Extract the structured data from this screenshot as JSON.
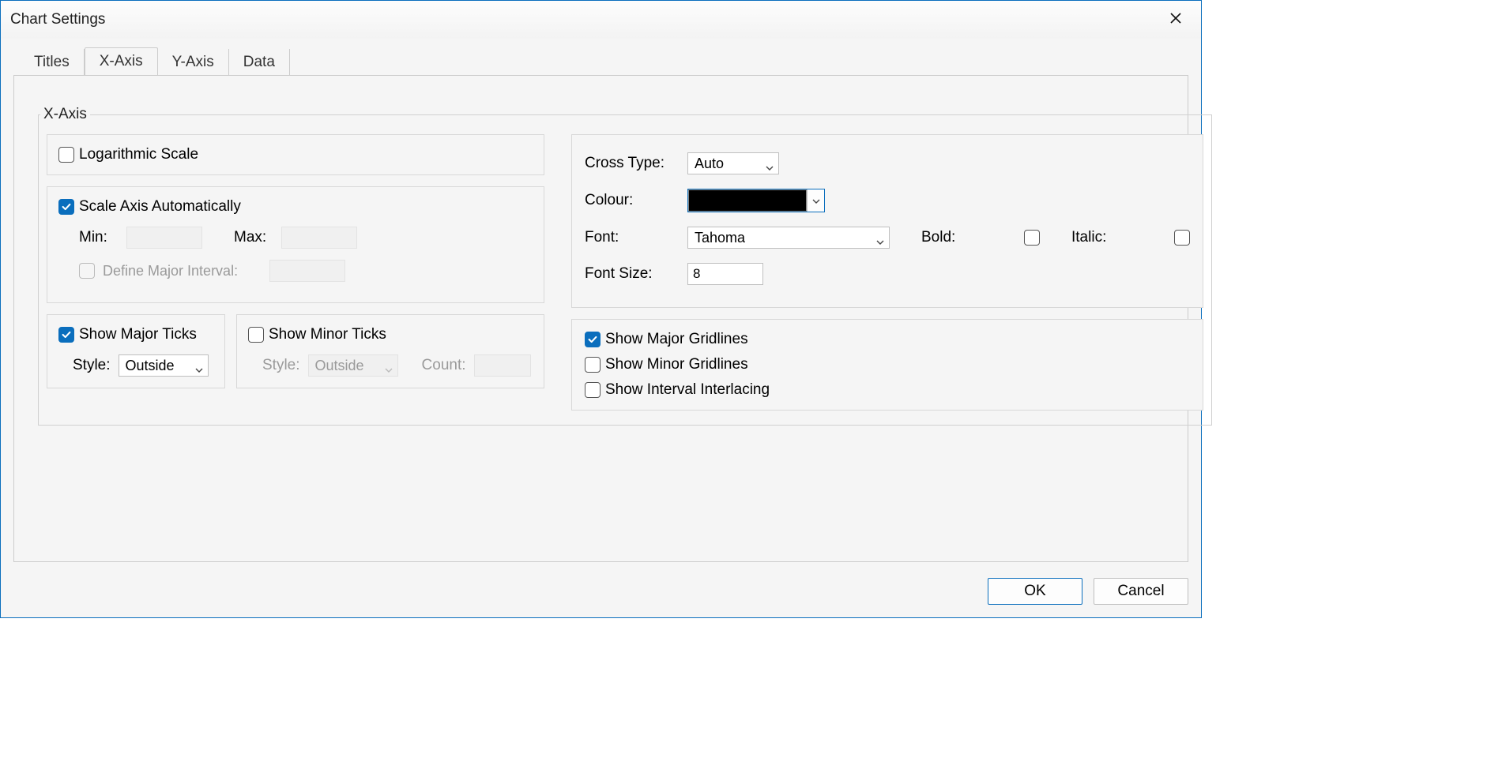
{
  "window": {
    "title": "Chart Settings"
  },
  "tabs": {
    "titles": "Titles",
    "xaxis": "X-Axis",
    "yaxis": "Y-Axis",
    "data": "Data"
  },
  "group": {
    "legend": "X-Axis"
  },
  "log": {
    "label": "Logarithmic Scale"
  },
  "scale": {
    "label": "Scale Axis Automatically",
    "min_label": "Min:",
    "max_label": "Max:",
    "min_value": "",
    "max_value": "",
    "interval_label": "Define Major Interval:",
    "interval_value": ""
  },
  "majorTicks": {
    "label": "Show Major Ticks",
    "style_label": "Style:",
    "style_value": "Outside"
  },
  "minorTicks": {
    "label": "Show Minor Ticks",
    "style_label": "Style:",
    "style_value": "Outside",
    "count_label": "Count:",
    "count_value": ""
  },
  "crossType": {
    "label": "Cross Type:",
    "value": "Auto"
  },
  "colour": {
    "label": "Colour:",
    "value": "#000000"
  },
  "font": {
    "label": "Font:",
    "value": "Tahoma"
  },
  "bold": {
    "label": "Bold:"
  },
  "italic": {
    "label": "Italic:"
  },
  "fontSize": {
    "label": "Font Size:",
    "value": "8"
  },
  "gridlines": {
    "major": "Show Major Gridlines",
    "minor": "Show Minor Gridlines",
    "interlace": "Show Interval Interlacing"
  },
  "buttons": {
    "ok": "OK",
    "cancel": "Cancel"
  }
}
